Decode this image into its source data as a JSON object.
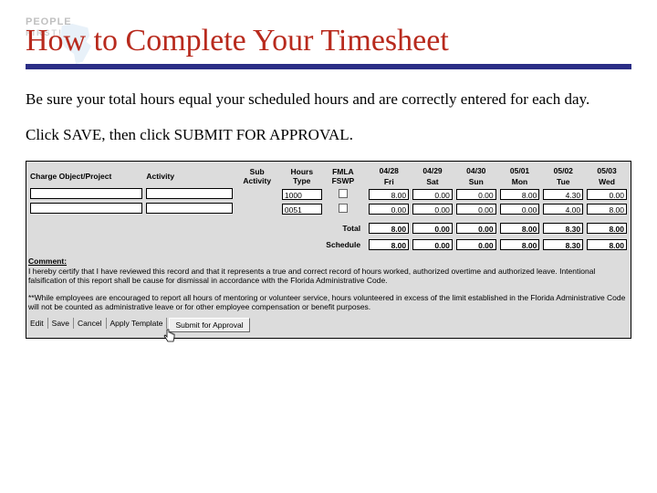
{
  "logo": {
    "line1": "PEOPLE",
    "line2": "FIRST!"
  },
  "title": "How to Complete Your Timesheet",
  "para1": "Be sure your total hours equal your scheduled hours and are correctly entered for each day.",
  "para2": "Click SAVE, then click SUBMIT FOR APPROVAL.",
  "grid": {
    "headers": {
      "charge": "Charge Object/Project",
      "activity": "Activity",
      "sub": "Sub Activity",
      "hours": "Hours Type",
      "fmla": "FMLA FSWP"
    },
    "days": [
      {
        "date": "04/28",
        "dow": "Fri"
      },
      {
        "date": "04/29",
        "dow": "Sat"
      },
      {
        "date": "04/30",
        "dow": "Sun"
      },
      {
        "date": "05/01",
        "dow": "Mon"
      },
      {
        "date": "05/02",
        "dow": "Tue"
      },
      {
        "date": "05/03",
        "dow": "Wed"
      }
    ],
    "rows": [
      {
        "hours_type": "1000",
        "vals": [
          "8.00",
          "0.00",
          "0.00",
          "8.00",
          "4.30",
          "0.00"
        ]
      },
      {
        "hours_type": "0051",
        "vals": [
          "0.00",
          "0.00",
          "0.00",
          "0.00",
          "4.00",
          "8.00"
        ]
      }
    ],
    "total_label": "Total",
    "total": [
      "8.00",
      "0.00",
      "0.00",
      "8.00",
      "8.30",
      "8.00"
    ],
    "schedule_label": "Schedule",
    "schedule": [
      "8.00",
      "0.00",
      "0.00",
      "8.00",
      "8.30",
      "8.00"
    ]
  },
  "comment": {
    "hdr": "Comment:",
    "certify": "I hereby certify that I have reviewed this record and that it represents a true and correct record of hours worked, authorized overtime and authorized leave. Intentional falsification of this report shall be cause for dismissal in accordance with the Florida Administrative Code.",
    "note": "**While employees are encouraged to report all hours of mentoring or volunteer service, hours volunteered in excess of the limit established in the Florida Administrative Code will not be counted as administrative leave or for other employee compensation or benefit purposes."
  },
  "buttons": {
    "edit": "Edit",
    "save": "Save",
    "cancel": "Cancel",
    "apply": "Apply Template",
    "submit": "Submit for Approval"
  }
}
